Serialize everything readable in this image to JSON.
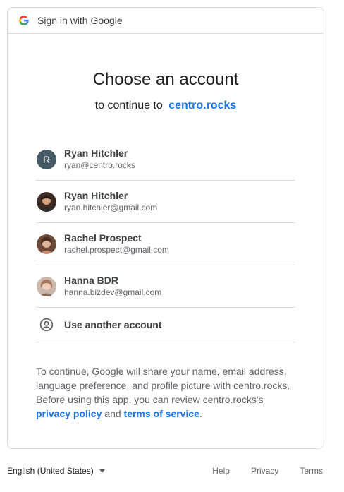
{
  "header": {
    "title": "Sign in with Google",
    "logo_icon": "google-g-icon"
  },
  "main": {
    "title": "Choose an account",
    "subtitle_prefix": "to continue to",
    "app_name": "centro.rocks"
  },
  "accounts": [
    {
      "name": "Ryan Hitchler",
      "email": "ryan@centro.rocks",
      "avatar": "R",
      "avatar_color": "#455a64"
    },
    {
      "name": "Ryan Hitchler",
      "email": "ryan.hitchler@gmail.com",
      "avatar_icon": "profile-photo-icon"
    },
    {
      "name": "Rachel Prospect",
      "email": "rachel.prospect@gmail.com",
      "avatar_icon": "profile-photo-icon"
    },
    {
      "name": "Hanna BDR",
      "email": "hanna.bizdev@gmail.com",
      "avatar_icon": "profile-photo-icon"
    }
  ],
  "use_another": {
    "label": "Use another account",
    "icon": "account-circle-icon"
  },
  "disclaimer": {
    "text": "To continue, Google will share your name, email address, language preference, and profile picture with centro.rocks. Before using this app, you can review centro.rocks's",
    "privacy_link": "privacy policy",
    "and": "and",
    "terms_link": "terms of service",
    "end": "."
  },
  "footer": {
    "language": "English (United States)",
    "links": [
      "Help",
      "Privacy",
      "Terms"
    ]
  },
  "colors": {
    "accent": "#1a73e8",
    "border": "#dadce0",
    "text": "#202124",
    "muted": "#5f6368"
  }
}
